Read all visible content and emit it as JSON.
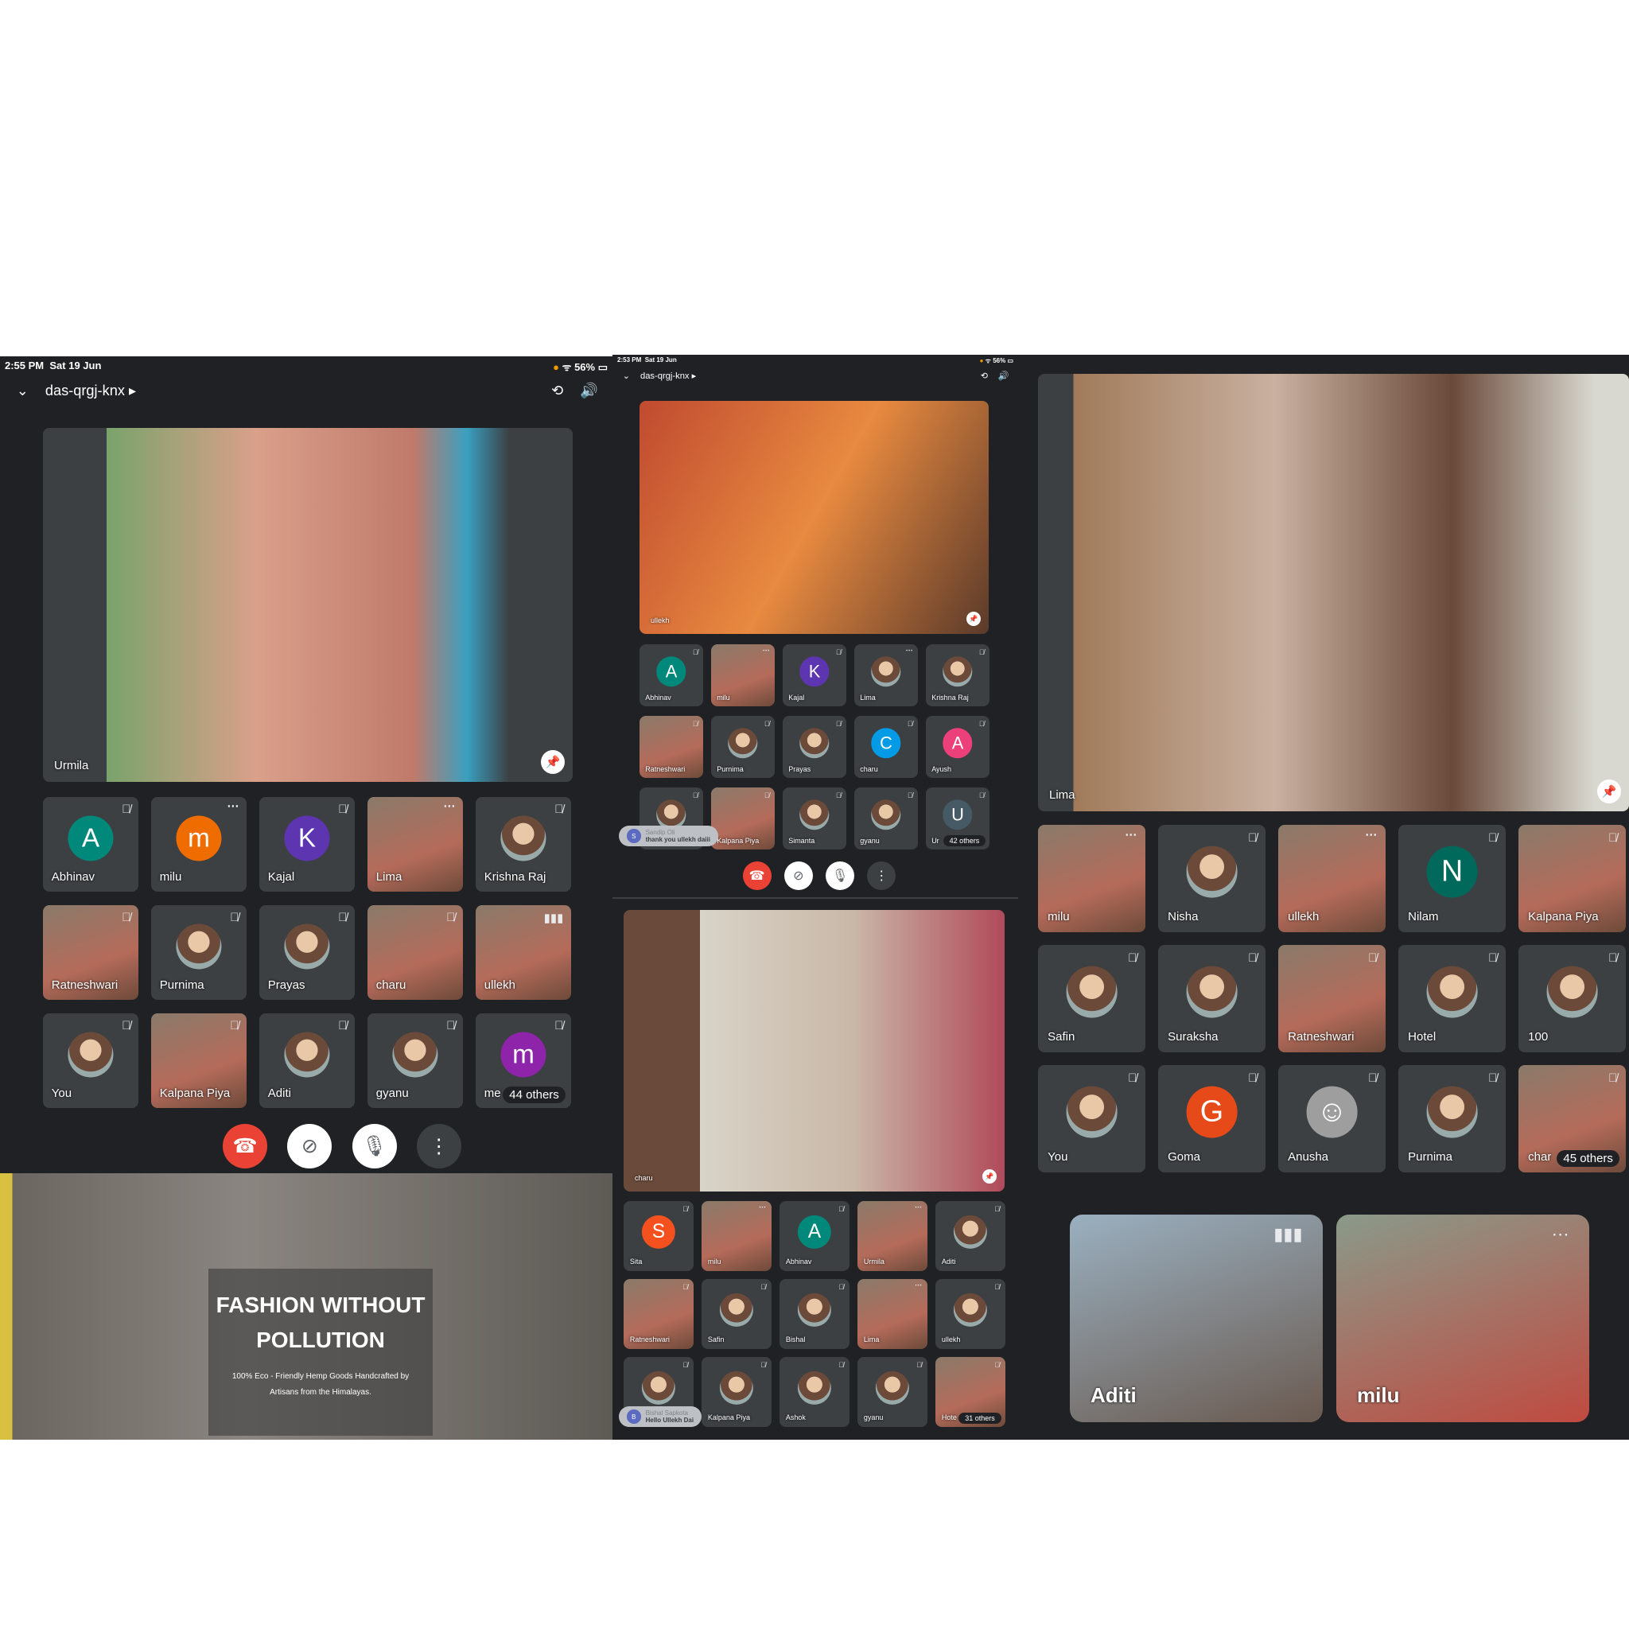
{
  "colors": {
    "panel_bg": "#202124",
    "tile_bg": "#3c4043",
    "end_call": "#ea4335"
  },
  "panels": [
    {
      "status": {
        "time": "2:55 PM",
        "date": "Sat 19 Jun",
        "battery": "56%"
      },
      "meeting_code": "das-qrgj-knx",
      "main": {
        "name": "Urmila"
      },
      "tiles": [
        {
          "name": "Abhinav",
          "letter": "A",
          "color": "#00897b",
          "mic": "muted"
        },
        {
          "name": "milu",
          "letter": "m",
          "color": "#ef6c00",
          "mic": "more"
        },
        {
          "name": "Kajal",
          "letter": "K",
          "color": "#5e35b1",
          "mic": "muted"
        },
        {
          "name": "Lima",
          "kind": "video",
          "mic": "more"
        },
        {
          "name": "Krishna Raj",
          "kind": "photo",
          "mic": "muted"
        },
        {
          "name": "Ratneshwari",
          "kind": "video",
          "mic": "muted"
        },
        {
          "name": "Purnima",
          "kind": "photo",
          "mic": "muted"
        },
        {
          "name": "Prayas",
          "kind": "photo",
          "mic": "muted"
        },
        {
          "name": "charu",
          "kind": "video",
          "mic": "muted"
        },
        {
          "name": "ullekh",
          "kind": "video",
          "mic": "speaking"
        },
        {
          "name": "You",
          "kind": "photo",
          "mic": "muted"
        },
        {
          "name": "Kalpana Piya",
          "kind": "video",
          "mic": "muted"
        },
        {
          "name": "Aditi",
          "kind": "photo",
          "mic": "muted"
        },
        {
          "name": "gyanu",
          "kind": "photo",
          "mic": "muted"
        },
        {
          "name": "me",
          "letter": "m",
          "color": "#8e24aa",
          "mic": "muted",
          "others": "44 others"
        }
      ],
      "share": {
        "title_line1": "FASHION WITHOUT",
        "title_line2": "POLLUTION",
        "subtitle": "100% Eco - Friendly Hemp Goods Handcrafted by Artisans from the Himalayas."
      }
    },
    {
      "status": {
        "time": "2:53 PM",
        "date": "Sat 19 Jun",
        "battery": "56%"
      },
      "meeting_code": "das-qrgj-knx",
      "main": {
        "name": "ullekh"
      },
      "tiles": [
        {
          "name": "Abhinav",
          "letter": "A",
          "color": "#00897b",
          "mic": "muted"
        },
        {
          "name": "milu",
          "kind": "video",
          "mic": "more"
        },
        {
          "name": "Kajal",
          "letter": "K",
          "color": "#5e35b1",
          "mic": "muted"
        },
        {
          "name": "Lima",
          "kind": "photo",
          "mic": "more"
        },
        {
          "name": "Krishna Raj",
          "kind": "photo",
          "mic": "muted"
        },
        {
          "name": "Ratneshwari",
          "kind": "video",
          "mic": "muted"
        },
        {
          "name": "Purnima",
          "kind": "photo",
          "mic": "muted"
        },
        {
          "name": "Prayas",
          "kind": "photo",
          "mic": "muted"
        },
        {
          "name": "charu",
          "letter": "C",
          "color": "#039be5",
          "mic": "muted"
        },
        {
          "name": "Ayush",
          "letter": "A",
          "color": "#ec407a",
          "mic": "muted"
        },
        {
          "name": "",
          "kind": "photo",
          "mic": "muted"
        },
        {
          "name": "Kalpana Piya",
          "kind": "video",
          "mic": "muted"
        },
        {
          "name": "Simanta",
          "kind": "photo",
          "mic": "muted"
        },
        {
          "name": "gyanu",
          "kind": "photo",
          "mic": "muted"
        },
        {
          "name": "Ur",
          "letter": "U",
          "color": "#455a64",
          "mic": "muted",
          "others": "42 others"
        }
      ],
      "chat": {
        "sender": "Sandip Oli",
        "initial": "S",
        "message": "thank you ullekh daiii"
      },
      "main2": {
        "name": "charu"
      },
      "tiles2": [
        {
          "name": "Sita",
          "letter": "S",
          "color": "#f4511e",
          "mic": "muted"
        },
        {
          "name": "milu",
          "kind": "video",
          "mic": "more"
        },
        {
          "name": "Abhinav",
          "letter": "A",
          "color": "#00897b",
          "mic": "muted"
        },
        {
          "name": "Urmila",
          "kind": "video",
          "mic": "more"
        },
        {
          "name": "Aditi",
          "kind": "photo",
          "mic": "muted"
        },
        {
          "name": "Ratneshwari",
          "kind": "video",
          "mic": "muted"
        },
        {
          "name": "Safin",
          "kind": "photo",
          "mic": "muted"
        },
        {
          "name": "Bishal",
          "kind": "photo",
          "mic": "muted"
        },
        {
          "name": "Lima",
          "kind": "video",
          "mic": "more"
        },
        {
          "name": "ullekh",
          "kind": "photo",
          "mic": "muted"
        },
        {
          "name": "",
          "kind": "photo",
          "mic": "muted"
        },
        {
          "name": "Kalpana Piya",
          "kind": "photo",
          "mic": "muted"
        },
        {
          "name": "Ashok",
          "kind": "photo",
          "mic": "muted"
        },
        {
          "name": "gyanu",
          "kind": "photo",
          "mic": "muted"
        },
        {
          "name": "Hote",
          "kind": "video",
          "mic": "muted",
          "others": "31 others"
        }
      ],
      "chat2": {
        "sender": "Bishal Sapkota",
        "initial": "B",
        "message": "Hello Ullekh Dai"
      }
    },
    {
      "main": {
        "name": "Lima"
      },
      "tiles": [
        {
          "name": "milu",
          "kind": "video",
          "mic": "more"
        },
        {
          "name": "Nisha",
          "kind": "photo",
          "mic": "muted"
        },
        {
          "name": "ullekh",
          "kind": "video",
          "mic": "more"
        },
        {
          "name": "Nilam",
          "letter": "N",
          "color": "#00695c",
          "mic": "muted"
        },
        {
          "name": "Kalpana Piya",
          "kind": "video",
          "mic": "muted"
        },
        {
          "name": "Safin",
          "kind": "photo",
          "mic": "muted"
        },
        {
          "name": "Suraksha",
          "kind": "photo",
          "mic": "muted"
        },
        {
          "name": "Ratneshwari",
          "kind": "video",
          "mic": "muted"
        },
        {
          "name": "Hotel",
          "kind": "photo",
          "mic": "muted"
        },
        {
          "name": "100",
          "kind": "photo",
          "mic": "muted"
        },
        {
          "name": "You",
          "kind": "photo",
          "mic": "muted"
        },
        {
          "name": "Goma",
          "letter": "G",
          "color": "#e64a19",
          "mic": "muted"
        },
        {
          "name": "Anusha",
          "letter": "☺",
          "color": "#9e9e9e",
          "mic": "muted"
        },
        {
          "name": "Purnima",
          "kind": "photo",
          "mic": "muted"
        },
        {
          "name": "char",
          "kind": "video",
          "mic": "muted",
          "others": "45 others"
        }
      ],
      "bottom": [
        {
          "name": "Aditi",
          "mic": "speaking"
        },
        {
          "name": "milu",
          "mic": "more"
        }
      ]
    }
  ]
}
